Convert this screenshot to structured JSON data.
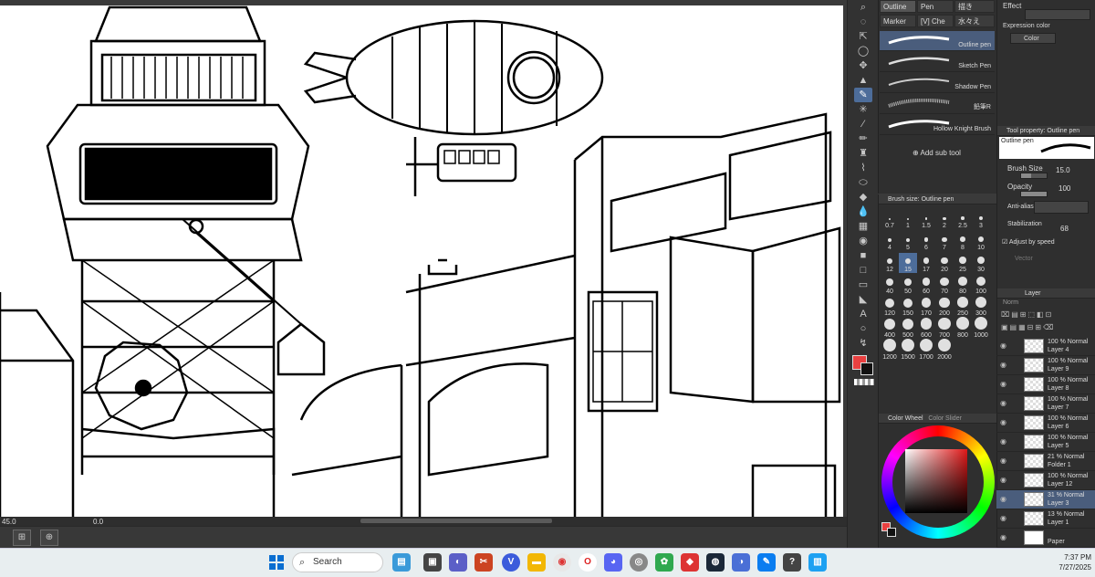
{
  "canvas": {
    "zoom": "45.0",
    "rotation": "0.0"
  },
  "subtool_tabs": [
    {
      "label": "Outline",
      "active": true
    },
    {
      "label": "Pen",
      "active": false
    },
    {
      "label": "描き",
      "active": false
    },
    {
      "label": "Marker",
      "active": false
    },
    {
      "label": "[V] Che",
      "active": false
    },
    {
      "label": "水々え",
      "active": false
    }
  ],
  "brushes": [
    {
      "name": "Outline pen",
      "active": true
    },
    {
      "name": "Sketch Pen",
      "active": false
    },
    {
      "name": "Shadow Pen",
      "active": false
    },
    {
      "name": "鉛筆R",
      "active": false
    },
    {
      "name": "Hollow Knight Brush",
      "active": false
    }
  ],
  "add_subtool_label": "Add sub tool",
  "brush_size_panel": {
    "title": "Brush size: Outline pen",
    "sizes": [
      "0.7",
      "1",
      "1.5",
      "2",
      "2.5",
      "3",
      "4",
      "5",
      "6",
      "7",
      "8",
      "10",
      "12",
      "15",
      "17",
      "20",
      "25",
      "30",
      "40",
      "50",
      "60",
      "70",
      "80",
      "100",
      "120",
      "150",
      "170",
      "200",
      "250",
      "300",
      "400",
      "500",
      "600",
      "700",
      "800",
      "1000",
      "1200",
      "1500",
      "1700",
      "2000"
    ],
    "selected": "15"
  },
  "color_wheel_title": "Color Wheel",
  "color_slider_title": "Color Slider",
  "colors": {
    "main": "#e94040",
    "sub": "#111111",
    "accent": "#4d6d9a"
  },
  "effect": {
    "title": "Effect",
    "expression_label": "Expression color",
    "expression_value": "Color"
  },
  "tool_property": {
    "title": "Tool property: Outline pen",
    "preview_label": "Outline pen",
    "brush_size_label": "Brush Size",
    "brush_size_value": "15.0",
    "opacity_label": "Opacity",
    "opacity_value": "100",
    "antialias_label": "Anti-alias",
    "stabilization_label": "Stabilization",
    "stabilization_value": "68",
    "adjust_speed_label": "Adjust by speed",
    "vector_label": "Vector"
  },
  "layer_panel": {
    "title": "Layer",
    "blend": "Norm"
  },
  "layers": [
    {
      "mode": "100 % Normal",
      "name": "Layer 4",
      "active": false
    },
    {
      "mode": "100 % Normal",
      "name": "Layer 9",
      "active": false
    },
    {
      "mode": "100 % Normal",
      "name": "Layer 8",
      "active": false
    },
    {
      "mode": "100 % Normal",
      "name": "Layer 7",
      "active": false
    },
    {
      "mode": "100 % Normal",
      "name": "Layer 6",
      "active": false
    },
    {
      "mode": "100 % Normal",
      "name": "Layer 5",
      "active": false
    },
    {
      "mode": "21 % Normal",
      "name": "Folder 1",
      "active": false
    },
    {
      "mode": "100 % Normal",
      "name": "Layer 12",
      "active": false
    },
    {
      "mode": "31 % Normal",
      "name": "Layer 3",
      "active": true
    },
    {
      "mode": "13 % Normal",
      "name": "Layer 1",
      "active": false
    },
    {
      "mode": "",
      "name": "Paper",
      "active": false
    }
  ],
  "taskbar": {
    "search_placeholder": "Search",
    "time": "7:37 PM",
    "date": "7/27/2025"
  }
}
